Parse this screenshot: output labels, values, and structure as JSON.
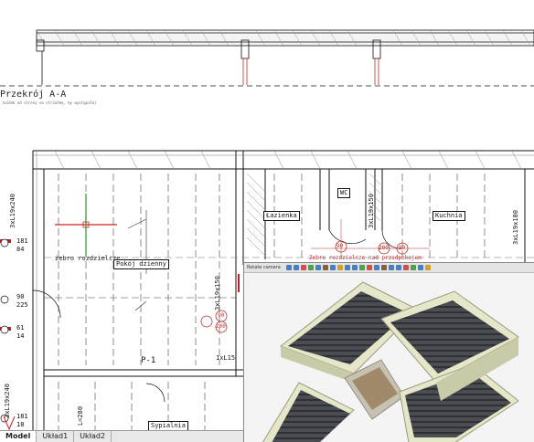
{
  "section_title": "Przekrój A-A",
  "section_note": "(widok od strony na strzałkę, by wystąpiła)",
  "rooms": {
    "wc": "WC",
    "lazienka": "Łazienka",
    "kuchnia": "Kuchnia",
    "pokoj": "Pokój dzienny",
    "sypialnia": "Sypialnia",
    "zebro": "żebro rozdzielcze",
    "elem": "Zebro rozdzielcze nad przedpokojem"
  },
  "dimensions": {
    "beam_a": "3xL19x240",
    "beam_b": "3xL19x240",
    "beam_c": "3xL19x150",
    "beam_d": "3xL19x150",
    "beam_e": "3xL19x180",
    "joist": "1xL15",
    "p1": "P-1",
    "l280": "L=280",
    "levels": [
      "181",
      "84",
      "90",
      "225",
      "61",
      "14",
      "181",
      "18"
    ],
    "circles": [
      "90",
      "200",
      "90",
      "200",
      "90"
    ]
  },
  "viewer": {
    "title": "Rotate camera",
    "toolbar_colors": [
      "#4a7fc0",
      "#4a7fc0",
      "#d05050",
      "#50a050",
      "#4a7fc0",
      "#806040",
      "#4a7fc0",
      "#d0a030",
      "#4a7fc0",
      "#4a7fc0",
      "#50a050",
      "#d05050",
      "#4a7fc0",
      "#806040",
      "#4a7fc0",
      "#4a7fc0",
      "#d05050",
      "#50a050",
      "#4a7fc0",
      "#d0a030"
    ]
  },
  "tabs": [
    "Model",
    "Układ1",
    "Układ2"
  ],
  "colors": {
    "cursor_green": "#2a9a2a",
    "cursor_red": "#d02020",
    "dim_red": "#b03030"
  }
}
